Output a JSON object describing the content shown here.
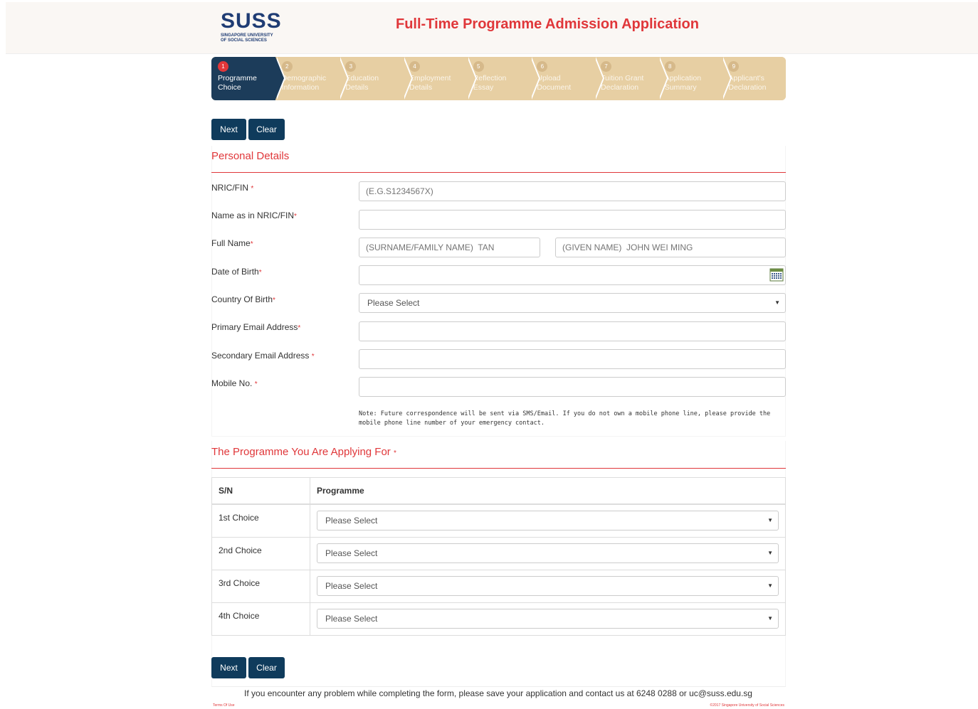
{
  "header": {
    "logo_text": "SUSS",
    "logo_sub_1": "SINGAPORE UNIVERSITY",
    "logo_sub_2": "OF SOCIAL SCIENCES",
    "title": "Full-Time Programme Admission Application"
  },
  "steps": [
    {
      "num": "1",
      "label": "Programme Choice",
      "active": true
    },
    {
      "num": "2",
      "label": "Demographic Information",
      "active": false
    },
    {
      "num": "3",
      "label": "Education Details",
      "active": false
    },
    {
      "num": "4",
      "label": "Employment Details",
      "active": false
    },
    {
      "num": "5",
      "label": "Reflection Essay",
      "active": false
    },
    {
      "num": "6",
      "label": "Upload Document",
      "active": false
    },
    {
      "num": "7",
      "label": "Tuition Grant Declaration",
      "active": false
    },
    {
      "num": "8",
      "label": "Application Summary",
      "active": false
    },
    {
      "num": "9",
      "label": "Applicant's Declaration",
      "active": false
    }
  ],
  "buttons": {
    "next": "Next",
    "clear": "Clear"
  },
  "personal": {
    "title": "Personal Details",
    "required_mark": "*",
    "nric_label": "NRIC/FIN",
    "nric_placeholder": "(E.G.S1234567X)",
    "name_label": "Name as in NRIC/FIN",
    "name_value": "",
    "fullname_label": "Full Name",
    "surname_placeholder": "(SURNAME/FAMILY NAME)  TAN",
    "given_placeholder": "(GIVEN NAME)  JOHN WEI MING",
    "dob_label": "Date of Birth",
    "dob_value": "",
    "country_label": "Country Of Birth",
    "country_value": "Please Select",
    "email1_label": "Primary Email Address",
    "email1_value": "",
    "email2_label": "Secondary Email Address",
    "email2_value": "",
    "mobile_label": "Mobile No.",
    "mobile_value": "",
    "note": "Note: Future correspondence will be sent via SMS/Email. If you do not own a mobile phone line, please provide the mobile phone line number of your emergency contact."
  },
  "programme": {
    "title": "The Programme You Are Applying For",
    "col_sn": "S/N",
    "col_programme": "Programme",
    "rows": [
      {
        "sn": "1st Choice",
        "value": "Please Select"
      },
      {
        "sn": "2nd Choice",
        "value": "Please Select"
      },
      {
        "sn": "3rd Choice",
        "value": "Please Select"
      },
      {
        "sn": "4th Choice",
        "value": "Please Select"
      }
    ]
  },
  "footer": {
    "help_text": "If you encounter any problem while completing the form, please save your application and contact us at 6248 0288 or uc@suss.edu.sg",
    "terms": "Terms Of Use",
    "copyright": "©2017 Singapore University of Social Sciences"
  },
  "colors": {
    "accent": "#e0373a",
    "navy": "#0f3b5c",
    "step_bg": "#e7cfa3"
  }
}
